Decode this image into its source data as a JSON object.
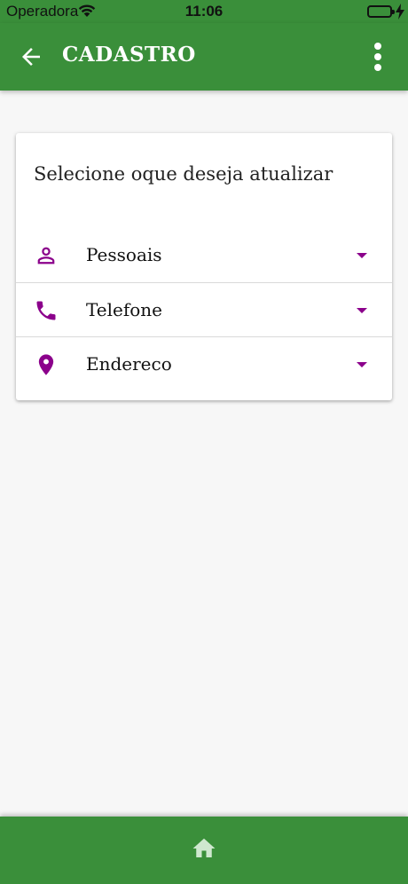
{
  "status_bar": {
    "carrier": "Operadora",
    "time": "11:06"
  },
  "app_bar": {
    "title": "CADASTRO"
  },
  "card": {
    "title": "Selecione oque deseja atualizar",
    "items": [
      {
        "label": "Pessoais",
        "icon": "person-icon"
      },
      {
        "label": "Telefone",
        "icon": "phone-icon"
      },
      {
        "label": "Endereco",
        "icon": "location-pin-icon"
      }
    ]
  },
  "colors": {
    "primary_green": "#3a8f3a",
    "accent_purple": "#8b008b",
    "background": "#f7f7f7"
  }
}
